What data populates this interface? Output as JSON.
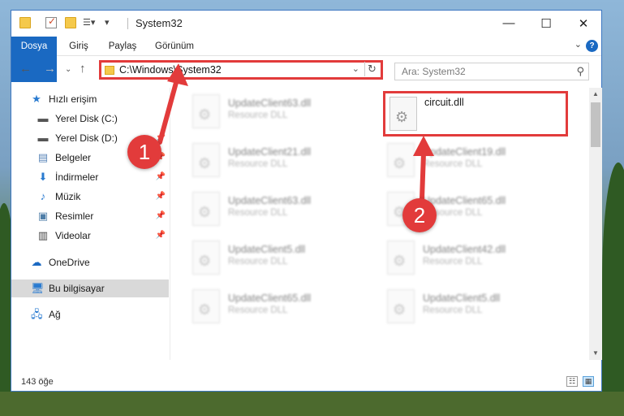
{
  "window": {
    "title": "System32",
    "controls": {
      "minimize": "—",
      "maximize": "☐",
      "close": "✕"
    }
  },
  "ribbon": {
    "tabs": [
      "Dosya",
      "Giriş",
      "Paylaş",
      "Görünüm"
    ],
    "help": "?"
  },
  "nav": {
    "address": "C:\\Windows\\System32",
    "search_placeholder": "Ara: System32"
  },
  "sidebar": {
    "items": [
      {
        "label": "Hızlı erişim",
        "icon": "star-icon",
        "pinned": false
      },
      {
        "label": "Yerel Disk (C:)",
        "icon": "drive-icon",
        "pinned": false
      },
      {
        "label": "Yerel Disk (D:)",
        "icon": "drive-icon",
        "pinned": true
      },
      {
        "label": "Belgeler",
        "icon": "documents-icon",
        "pinned": true
      },
      {
        "label": "İndirmeler",
        "icon": "download-icon",
        "pinned": true
      },
      {
        "label": "Müzik",
        "icon": "music-icon",
        "pinned": true
      },
      {
        "label": "Resimler",
        "icon": "pictures-icon",
        "pinned": true
      },
      {
        "label": "Videolar",
        "icon": "videos-icon",
        "pinned": true
      },
      {
        "label": "OneDrive",
        "icon": "cloud-icon",
        "pinned": false
      },
      {
        "label": "Bu bilgisayar",
        "icon": "computer-icon",
        "pinned": false
      },
      {
        "label": "Ağ",
        "icon": "network-icon",
        "pinned": false
      }
    ]
  },
  "files": {
    "left": [
      {
        "name": "UpdateClient63.dll",
        "type": "Resource DLL"
      },
      {
        "name": "UpdateClient21.dll",
        "type": "Resource DLL"
      },
      {
        "name": "UpdateClient63.dll",
        "type": "Resource DLL"
      },
      {
        "name": "UpdateClient5.dll",
        "type": "Resource DLL"
      },
      {
        "name": "UpdateClient65.dll",
        "type": "Resource DLL"
      }
    ],
    "right": [
      {
        "name": "circuit.dll",
        "type": ""
      },
      {
        "name": "UpdateClient19.dll",
        "type": "Resource DLL"
      },
      {
        "name": "UpdateClient65.dll",
        "type": "Resource DLL"
      },
      {
        "name": "UpdateClient42.dll",
        "type": "Resource DLL"
      },
      {
        "name": "UpdateClient5.dll",
        "type": "Resource DLL"
      }
    ]
  },
  "status": {
    "item_count": "143 öğe"
  },
  "callouts": {
    "one": "1",
    "two": "2",
    "color": "#e23b3b"
  }
}
